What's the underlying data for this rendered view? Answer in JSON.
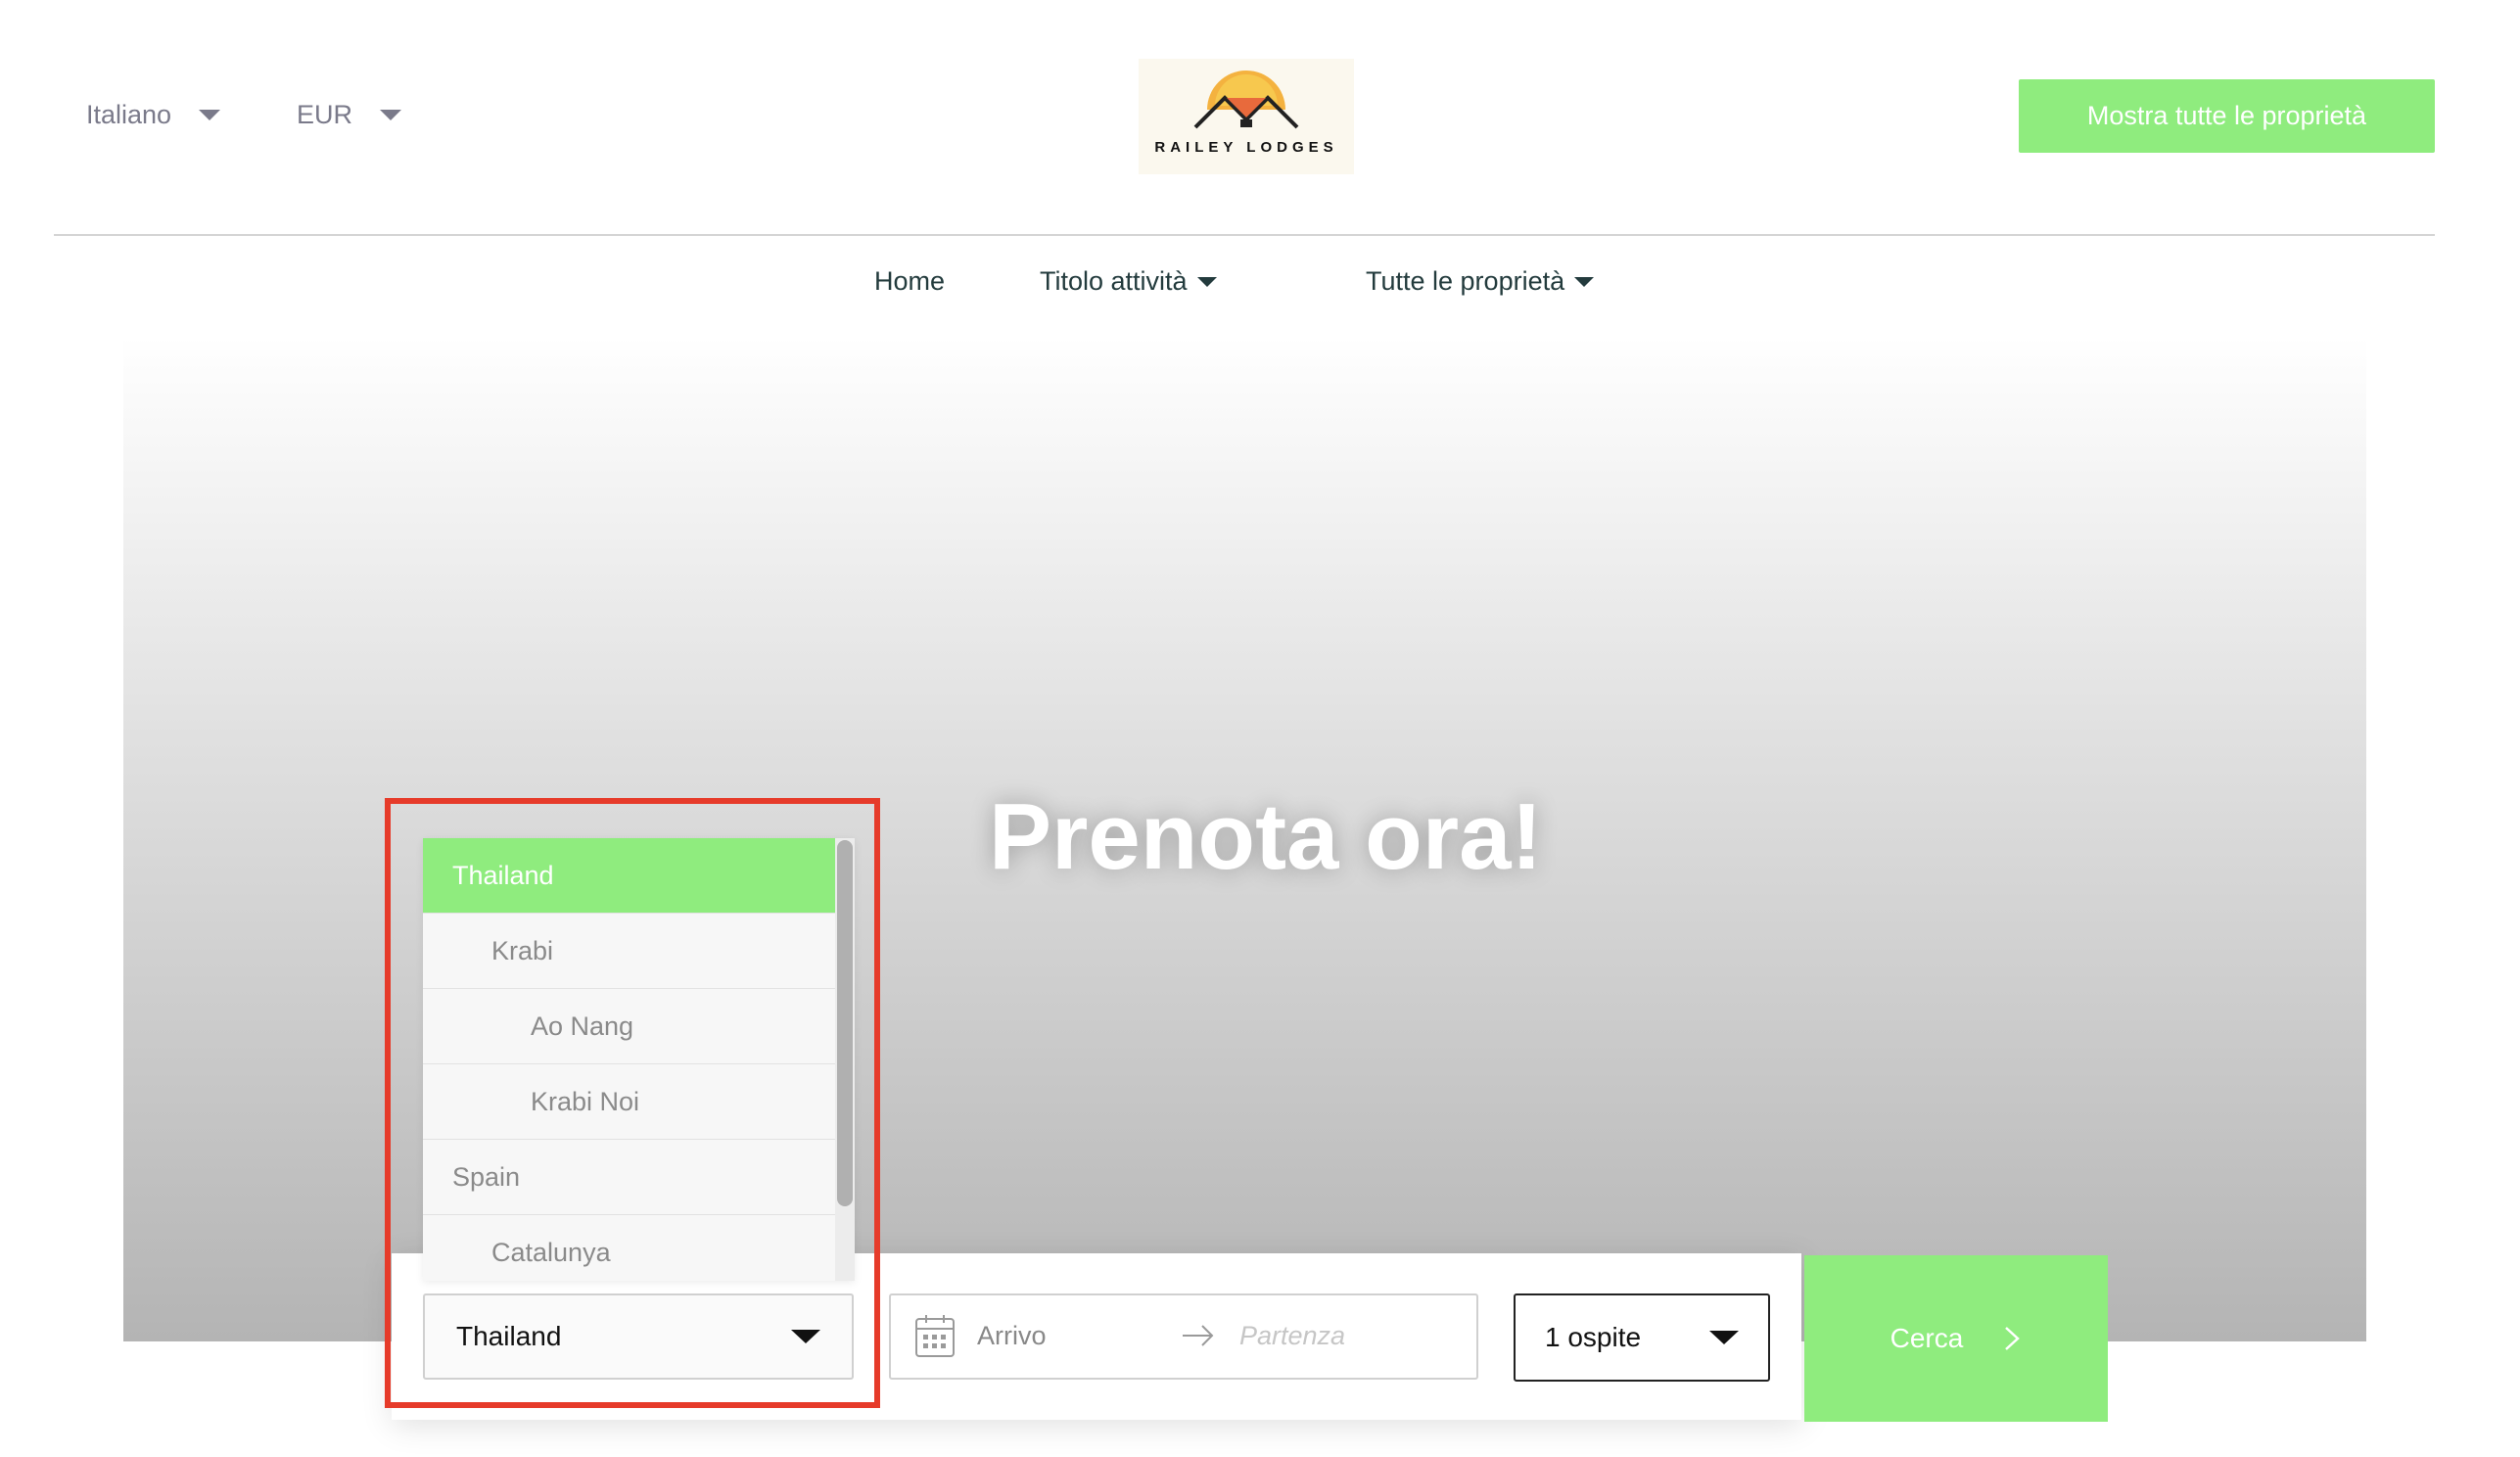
{
  "header": {
    "language": "Italiano",
    "currency": "EUR",
    "logo_text": "RAILEY LODGES",
    "cta_label": "Mostra tutte le proprietà"
  },
  "nav": {
    "home": "Home",
    "activity": "Titolo attività",
    "properties": "Tutte le proprietà"
  },
  "hero": {
    "title": "Prenota ora!"
  },
  "search": {
    "destination_value": "Thailand",
    "arrival_placeholder": "Arrivo",
    "departure_placeholder": "Partenza",
    "guests_value": "1 ospite",
    "search_label": "Cerca"
  },
  "dropdown": {
    "options": [
      {
        "label": "Thailand",
        "level": 0,
        "selected": true
      },
      {
        "label": "Krabi",
        "level": 1
      },
      {
        "label": "Ao Nang",
        "level": 2
      },
      {
        "label": "Krabi Noi",
        "level": 2
      },
      {
        "label": "Spain",
        "level": 0
      },
      {
        "label": "Catalunya",
        "level": 1
      }
    ]
  },
  "colors": {
    "accent_green": "#8fec7e",
    "highlight_red": "#e63b2a",
    "nav_text": "#233b3d"
  },
  "icons": [
    "chevron-down-icon",
    "calendar-icon",
    "arrow-right-icon",
    "chevron-right-icon"
  ]
}
